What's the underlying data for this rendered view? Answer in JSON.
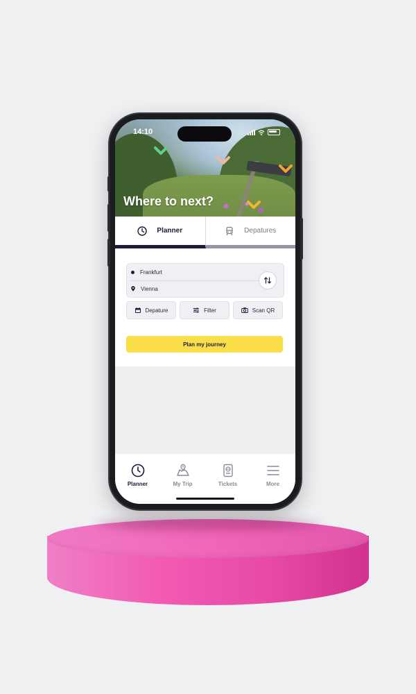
{
  "status_bar": {
    "time": "14:10"
  },
  "hero": {
    "title": "Where to next?"
  },
  "tabs": [
    {
      "label": "Planner",
      "icon": "clock-icon",
      "active": true
    },
    {
      "label": "Depatures",
      "icon": "train-icon",
      "active": false
    }
  ],
  "route": {
    "from": "Frankfurt",
    "to": "Vienna"
  },
  "chips": [
    {
      "label": "Depature",
      "icon": "calendar-icon"
    },
    {
      "label": "Filter",
      "icon": "sliders-icon"
    },
    {
      "label": "Scan QR",
      "icon": "camera-icon"
    }
  ],
  "plan_button": {
    "label": "Plan my journey"
  },
  "bottom_nav": [
    {
      "label": "Planner",
      "icon": "clock-icon",
      "active": true
    },
    {
      "label": "My Trip",
      "icon": "map-icon",
      "active": false
    },
    {
      "label": "Tickets",
      "icon": "ticket-icon",
      "active": false
    },
    {
      "label": "More",
      "icon": "menu-icon",
      "active": false
    }
  ],
  "colors": {
    "accent_yellow": "#fbdf4a",
    "navy": "#1d1b3a",
    "pedestal_pink": "#f066b9"
  }
}
